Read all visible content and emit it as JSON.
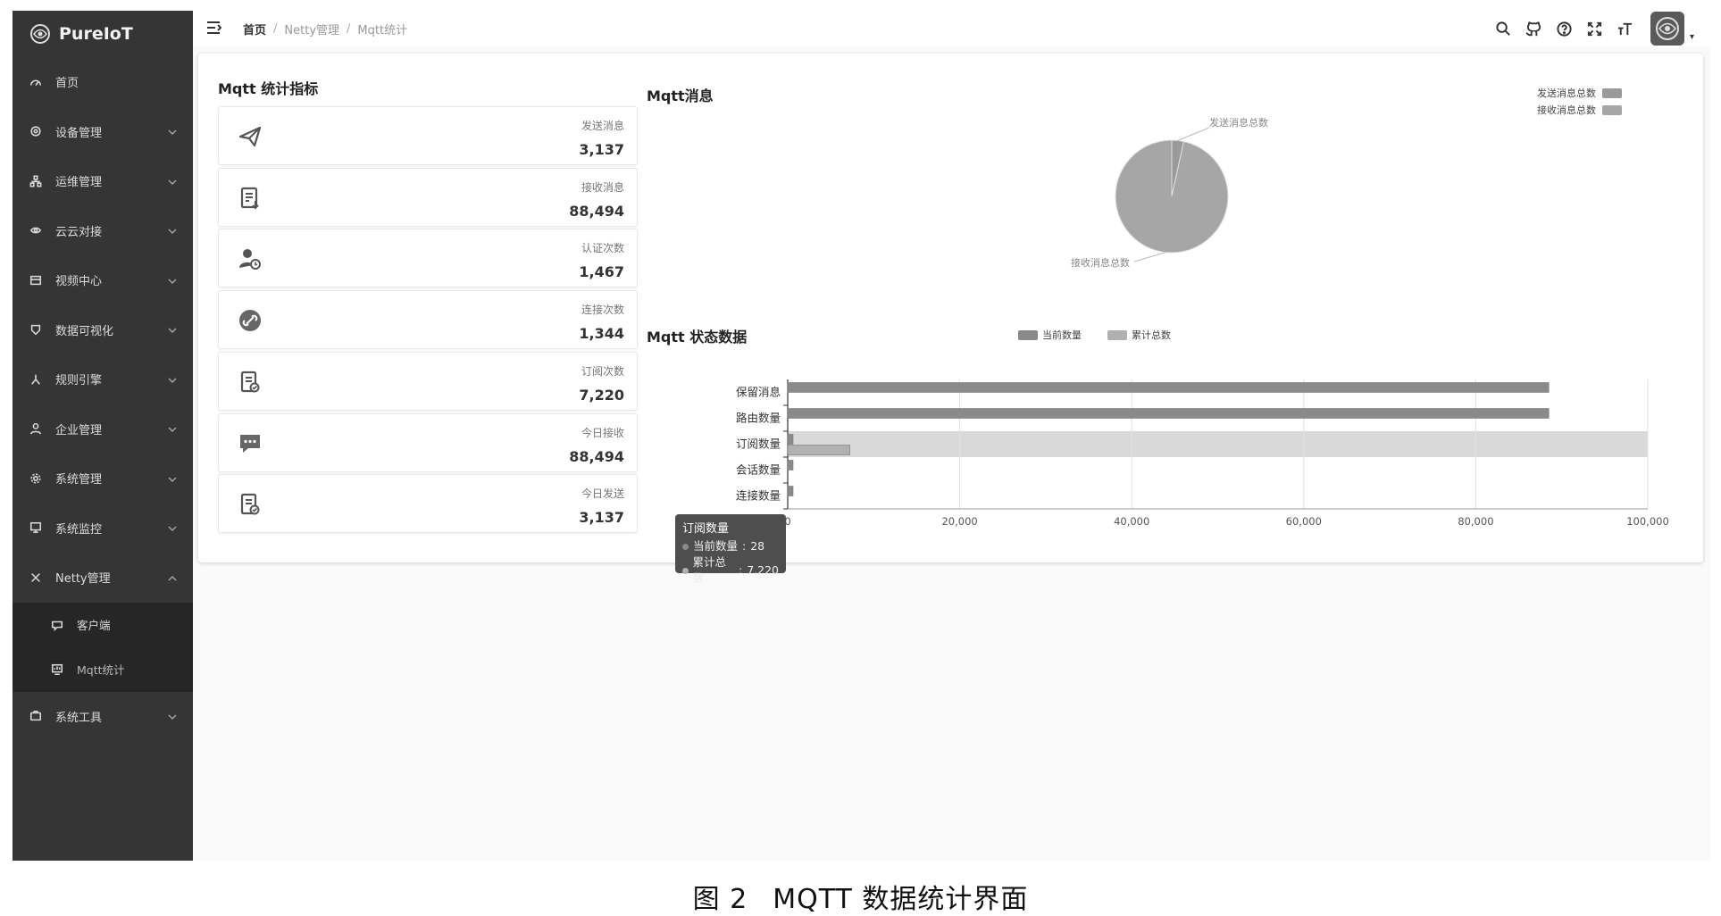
{
  "app": {
    "logo": "PureIoT"
  },
  "sidebar": {
    "items": [
      {
        "label": "首页",
        "icon": "dashboard-icon",
        "has_arrow": false
      },
      {
        "label": "设备管理",
        "icon": "device-icon",
        "has_arrow": true
      },
      {
        "label": "运维管理",
        "icon": "org-icon",
        "has_arrow": true
      },
      {
        "label": "云云对接",
        "icon": "link-icon",
        "has_arrow": true
      },
      {
        "label": "视频中心",
        "icon": "video-icon",
        "has_arrow": true
      },
      {
        "label": "数据可视化",
        "icon": "chart-icon",
        "has_arrow": true
      },
      {
        "label": "规则引擎",
        "icon": "rule-icon",
        "has_arrow": true
      },
      {
        "label": "企业管理",
        "icon": "enterprise-icon",
        "has_arrow": true
      },
      {
        "label": "系统管理",
        "icon": "gear-icon",
        "has_arrow": true
      },
      {
        "label": "系统监控",
        "icon": "monitor-icon",
        "has_arrow": true
      },
      {
        "label": "Netty管理",
        "icon": "netty-icon",
        "has_arrow": true,
        "expanded": true
      }
    ],
    "submenu": [
      {
        "label": "客户端",
        "icon": "client-icon"
      },
      {
        "label": "Mqtt统计",
        "icon": "stats-icon",
        "active": true
      }
    ],
    "bottom_item": {
      "label": "系统工具",
      "icon": "tools-icon"
    }
  },
  "header": {
    "breadcrumb": {
      "home": "首页",
      "parent": "Netty管理",
      "current": "Mqtt统计",
      "sep": "/"
    },
    "tools": [
      "search-icon",
      "github-icon",
      "help-icon",
      "fullscreen-icon",
      "font-size-icon"
    ]
  },
  "stats": {
    "title": "Mqtt 统计指标",
    "cards": [
      {
        "label": "发送消息",
        "value": "3,137",
        "icon": "paper-plane-icon"
      },
      {
        "label": "接收消息",
        "value": "88,494",
        "icon": "receive-doc-icon"
      },
      {
        "label": "认证次数",
        "value": "1,467",
        "icon": "user-auth-icon"
      },
      {
        "label": "连接次数",
        "value": "1,344",
        "icon": "connect-icon"
      },
      {
        "label": "订阅次数",
        "value": "7,220",
        "icon": "subscribe-doc-icon"
      },
      {
        "label": "今日接收",
        "value": "88,494",
        "icon": "chat-icon"
      },
      {
        "label": "今日发送",
        "value": "3,137",
        "icon": "send-doc-icon"
      }
    ]
  },
  "chart_data": [
    {
      "type": "pie",
      "title": "Mqtt消息",
      "legend_position": "top-right",
      "slices": [
        {
          "name": "发送消息总数",
          "value": 3137,
          "color": "#9a9a9a"
        },
        {
          "name": "接收消息总数",
          "value": 88494,
          "color": "#a6a6a6"
        }
      ]
    },
    {
      "type": "bar",
      "orientation": "horizontal",
      "title": "Mqtt 状态数据",
      "legend_position": "top",
      "categories": [
        "保留消息",
        "路由数量",
        "订阅数量",
        "会话数量",
        "连接数量"
      ],
      "series": [
        {
          "name": "当前数量",
          "color": "#8a8a8a",
          "values": [
            88494,
            88494,
            28,
            5,
            5
          ]
        },
        {
          "name": "累计总数",
          "color": "#b0b0b0",
          "values": [
            0,
            0,
            7220,
            0,
            0
          ]
        }
      ],
      "xlim": [
        0,
        100000
      ],
      "xticks": [
        "0",
        "20,000",
        "40,000",
        "60,000",
        "80,000",
        "100,000"
      ],
      "highlighted_category": "订阅数量",
      "tooltip": {
        "title": "订阅数量",
        "rows": [
          {
            "label": "当前数量",
            "value": "28"
          },
          {
            "label": "累计总数",
            "value": "7,220"
          }
        ]
      }
    }
  ],
  "caption": {
    "num": "图 2",
    "text": "MQTT 数据统计界面"
  }
}
